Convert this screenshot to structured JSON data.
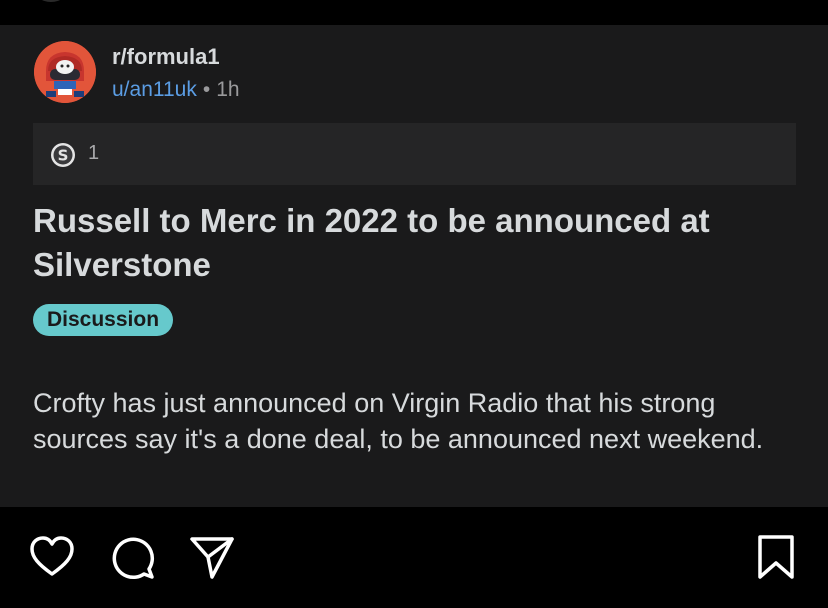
{
  "post": {
    "subreddit": "r/formula1",
    "username": "u/an11uk",
    "separator": "•",
    "time_ago": "1h",
    "award": {
      "icon": "silver-award-icon",
      "count": "1"
    },
    "title": "Russell to Merc in 2022 to be announced at Silverstone",
    "flair": {
      "label": "Discussion",
      "color": "#66c9cc"
    },
    "body": "Crofty has just announced on Virgin Radio that his strong sources say it's a done deal, to be announced next weekend."
  },
  "action_bar": {
    "icons": [
      "heart-icon",
      "comment-icon",
      "send-icon",
      "bookmark-icon"
    ]
  },
  "colors": {
    "card_background": "#1a1a1b",
    "award_bar_background": "#252526",
    "username_link": "#5b9de4",
    "avatar_background": "#e2553a"
  }
}
